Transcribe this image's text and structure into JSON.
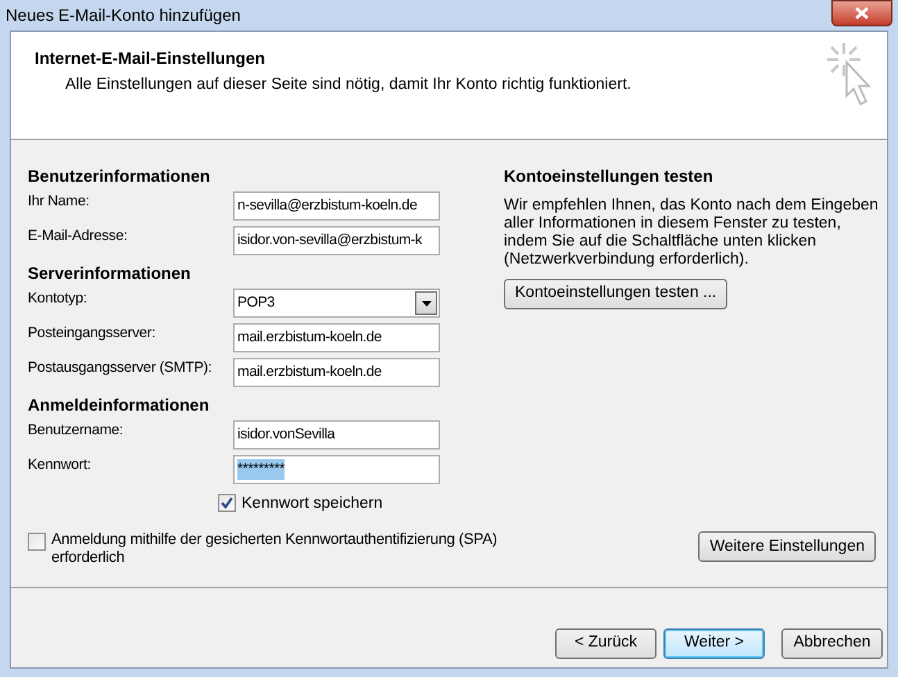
{
  "window": {
    "title": "Neues E-Mail-Konto hinzufügen"
  },
  "header": {
    "title": "Internet-E-Mail-Einstellungen",
    "subtitle": "Alle Einstellungen auf dieser Seite sind nötig, damit Ihr Konto richtig funktioniert."
  },
  "sections": [
    {
      "heading": "Benutzerinformationen",
      "fields": [
        {
          "kind": "text",
          "label": "Ihr Name:",
          "value": "n-sevilla@erzbistum-koeln.de"
        },
        {
          "kind": "text",
          "label": "E-Mail-Adresse:",
          "value": "isidor.von-sevilla@erzbistum-k"
        }
      ]
    },
    {
      "heading": "Serverinformationen",
      "fields": [
        {
          "kind": "dropdown",
          "label": "Kontotyp:",
          "value": "POP3"
        },
        {
          "kind": "text",
          "label": "Posteingangsserver:",
          "value": "mail.erzbistum-koeln.de"
        },
        {
          "kind": "text",
          "label": "Postausgangsserver (SMTP):",
          "value": "mail.erzbistum-koeln.de"
        }
      ]
    },
    {
      "heading": "Anmeldeinformationen",
      "fields": [
        {
          "kind": "text",
          "label": "Benutzername:",
          "value": "isidor.vonSevilla"
        },
        {
          "kind": "password",
          "label": "Kennwort:",
          "value": "*********",
          "selected": true
        }
      ]
    }
  ],
  "remember_password": {
    "label": "Kennwort speichern",
    "checked": true
  },
  "spa": {
    "label": "Anmeldung mithilfe der gesicherten Kennwortauthentifizierung (SPA) erforderlich",
    "checked": false
  },
  "test_panel": {
    "heading": "Kontoeinstellungen testen",
    "text": "Wir empfehlen Ihnen, das Konto nach dem Eingeben aller Informationen in diesem Fenster zu testen, indem Sie auf die Schaltfläche unten klicken (Netzwerkverbindung erforderlich).",
    "button": "Kontoeinstellungen testen ..."
  },
  "more_settings_button": "Weitere Einstellungen",
  "buttons": [
    {
      "label": "< Zurück",
      "default": false
    },
    {
      "label": "Weiter >",
      "default": true
    },
    {
      "label": "Abbrechen",
      "default": false
    }
  ]
}
